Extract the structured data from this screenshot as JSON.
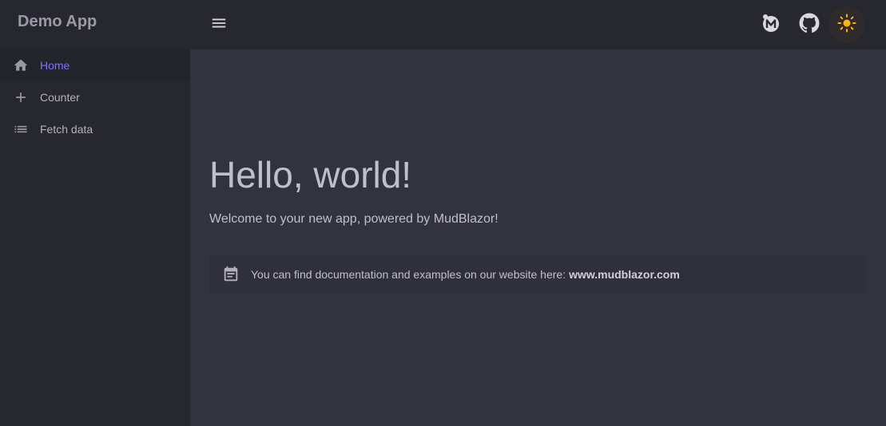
{
  "brand": {
    "title": "Demo App"
  },
  "nav": {
    "items": [
      {
        "label": "Home",
        "icon": "home-icon",
        "active": true
      },
      {
        "label": "Counter",
        "icon": "plus-icon",
        "active": false
      },
      {
        "label": "Fetch data",
        "icon": "list-icon",
        "active": false
      }
    ]
  },
  "appbar": {
    "actions": [
      {
        "icon": "mudblazor-icon"
      },
      {
        "icon": "github-icon"
      },
      {
        "icon": "sun-icon"
      }
    ]
  },
  "main": {
    "heading": "Hello, world!",
    "subtitle": "Welcome to your new app, powered by MudBlazor!",
    "alert": {
      "text": "You can find documentation and examples on our website here:",
      "link": "www.mudblazor.com",
      "icon": "calendar-note-icon"
    }
  },
  "colors": {
    "accent": "#7e6fff",
    "sun": "#ffb300",
    "background": "#32333d",
    "drawer": "#27272f"
  }
}
